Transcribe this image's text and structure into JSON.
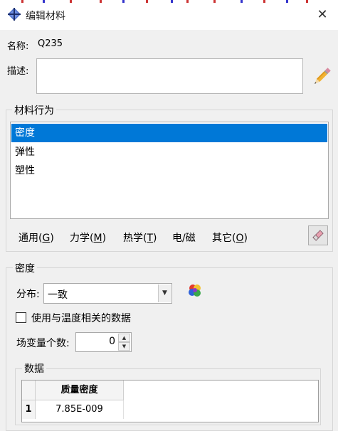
{
  "window": {
    "title": "编辑材料",
    "close_glyph": "✕",
    "icon": "material-diamond-icon"
  },
  "material": {
    "name_label": "名称:",
    "name_value": "Q235",
    "description_label": "描述:",
    "description_value": ""
  },
  "behaviors": {
    "group_title": "材料行为",
    "items": [
      {
        "label": "密度",
        "selected": true
      },
      {
        "label": "弹性",
        "selected": false
      },
      {
        "label": "塑性",
        "selected": false
      }
    ]
  },
  "menu": {
    "items": [
      {
        "text": "通用(",
        "key": "G",
        "end": ")"
      },
      {
        "text": "力学(",
        "key": "M",
        "end": ")"
      },
      {
        "text": "热学(",
        "key": "T",
        "end": ")"
      },
      {
        "text": "电/磁",
        "key": "",
        "end": ""
      },
      {
        "text": "其它(",
        "key": "O",
        "end": ")"
      }
    ]
  },
  "density": {
    "group_title": "密度",
    "distribution_label": "分布:",
    "distribution_value": "一致",
    "temp_dependent_label": "使用与温度相关的数据",
    "temp_dependent_checked": false,
    "field_vars_label": "场变量个数:",
    "field_vars_value": "0"
  },
  "data": {
    "group_title": "数据",
    "columns": [
      "质量密度"
    ],
    "rows": [
      {
        "index": "1",
        "values": [
          "7.85E-009"
        ]
      }
    ]
  },
  "colors": {
    "selection": "#0078d7",
    "dialog_bg": "#f0f0f0",
    "title_bg": "#ffffff"
  }
}
